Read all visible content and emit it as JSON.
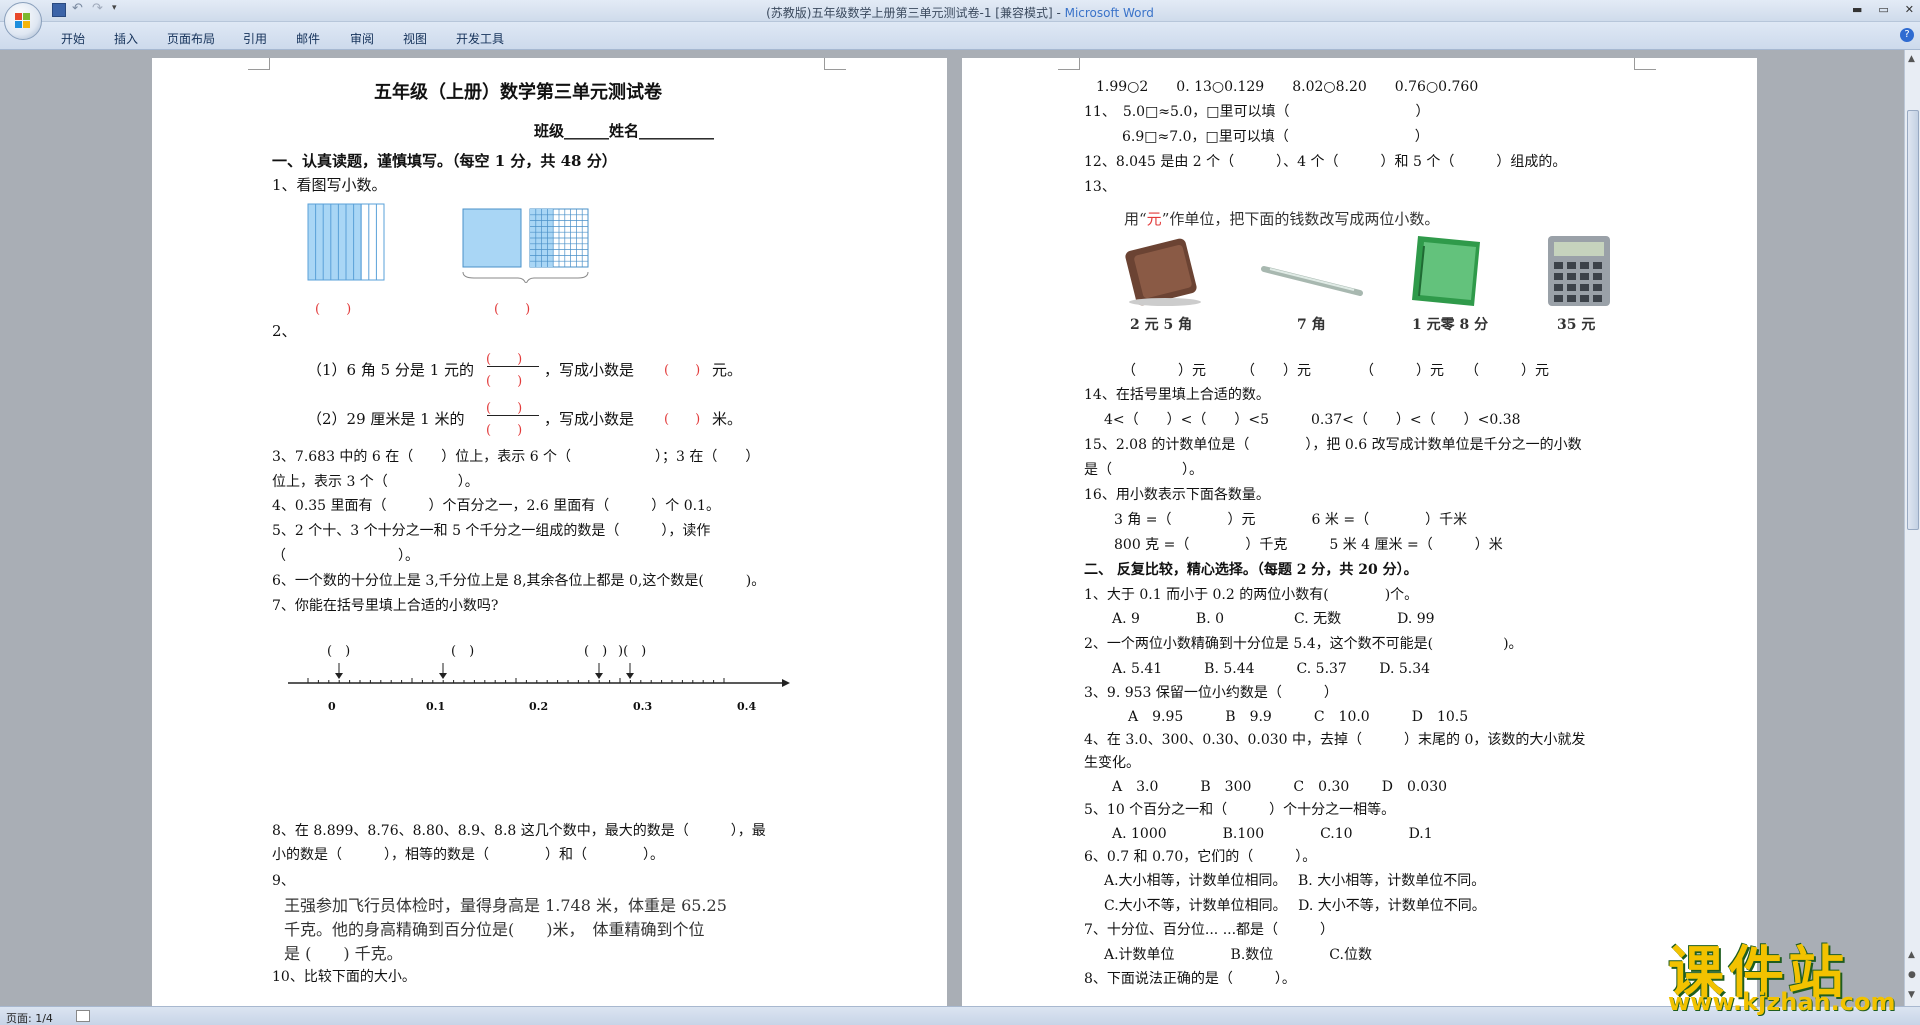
{
  "window": {
    "title_prefix": "(苏教版)五年级数学上册第三单元测试卷-1 [兼容模式] - ",
    "title_app": "Microsoft Word"
  },
  "ribbon": {
    "tabs": [
      "开始",
      "插入",
      "页面布局",
      "引用",
      "邮件",
      "审阅",
      "视图",
      "开发工具"
    ]
  },
  "status": {
    "page": "页面: 1/4"
  },
  "watermark": {
    "main": "课件站",
    "url": "www.kjzhan.com"
  },
  "page1": {
    "title": "五年级（上册）数学第三单元测试卷",
    "classline": "班级______姓名__________",
    "sec1": "一、认真读题，谨慎填写。（每空 1 分，共 48 分）",
    "q1": "1、看图写小数。",
    "q1_blank": "(　　)",
    "q2": "2、",
    "q2_1a": "（1）6 角 5 分是 1 元的",
    "q2_1b": "，写成小数是",
    "q2_1c": "元。",
    "q2_2a": "（2）29 厘米是 1 米的",
    "q2_2b": "，写成小数是",
    "q2_2c": "米。",
    "paren": "(　　)",
    "q3a": "3、7.683 中的 6 在（　　）位上，表示 6 个（　　　　　　）；3 在（　　）",
    "q3b": "位上，表示 3 个（　　　　　）。",
    "q4": "4、0.35 里面有（　　　）个百分之一，2.6 里面有（　　　）个 0.1。",
    "q5a": "5、2 个十、3 个十分之一和 5 个千分之一组成的数是（　　　），读作",
    "q5b": "（　　　　　　　　）。",
    "q6": "6、一个数的十分位上是 3,千分位上是 8,其余各位上都是 0,这个数是(　　　)。",
    "q7": "7、你能在括号里填上合适的小数吗?",
    "numberline": {
      "ticks": [
        "0",
        "0.1",
        "0.2",
        "0.3",
        "0.4"
      ],
      "paren": "(　)",
      "paren2": ")(　)"
    },
    "q8a": "8、在 8.899、8.76、8.80、8.9、8.8 这几个数中，最大的数是（　　　），最",
    "q8b": "小的数是（　　　），相等的数是（　　　　）和（　　　　）。",
    "q9": "9、",
    "q9a": "王强参加飞行员体检时，量得身高是 1.748 米，体重是 65.25",
    "q9b": "千克。他的身高精确到百分位是(　　)米，　体重精确到个位",
    "q9c": "是 (　　) 千克。",
    "q10": "10、比较下面的大小。"
  },
  "page2": {
    "cmp": "1.99○2　　0. 13○0.129　　8.02○8.20　　0.76○0.760",
    "q11a": "11、　5.0□≈5.0，□里可以填（　　　　　　　　　）",
    "q11b": "6.9□≈7.0，□里可以填（　　　　　　　　　）",
    "q12": "12、8.045 是由 2 个（　　　）、4 个（　　　）和 5 个（　　　）组成的。",
    "q13": "13、",
    "q13_inst_a": "用“",
    "q13_inst_yuan": "元",
    "q13_inst_b": "”作单位，把下面的钱数改写成两位小数。",
    "items": [
      "2 元 5 角",
      "7 角",
      "1 元零 8 分",
      "35 元"
    ],
    "q13_answers": "（　　　）元　　　（　　）元　　　　（　　　）元　　（　　　）元",
    "q14": "14、在括号里填上合适的数。",
    "q14b": "4<（　　）<（　　）<5　　　0.37<（　　）<（　　）<0.38",
    "q15a": "15、2.08 的计数单位是（　　　　），把 0.6 改写成计数单位是千分之一的小数",
    "q15b": "是（　　　　　）。",
    "q16": "16、用小数表示下面各数量。",
    "q16a": "3 角 =（　　　　）元　　　　6 米 =（　　　　）千米",
    "q16b": "800 克 =（　　　　）千克　　　5 米 4 厘米 =（　　　）米",
    "sec2": "二、 反复比较，精心选择。（每题 2 分，共 20 分）。",
    "c1": "1、大于 0.1 而小于 0.2 的两位小数有(　　　　)个。",
    "c1o": "A. 9　　　　B. 0　　　　　C. 无数　　　　D. 99",
    "c2": "2、一个两位小数精确到十分位是 5.4，这个数不可能是(　　　　　)。",
    "c2o": "A. 5.41　　　B. 5.44　　　C. 5.37　　 D. 5.34",
    "c3": "3、9. 953 保留一位小约数是（　　　）",
    "c3o": "A　9.95　　　B　9.9　　　C　10.0　　　D　10.5",
    "c4a": "4、在 3.0、300、0.30、0.030 中，去掉（　　　）末尾的 0，该数的大小就发",
    "c4b": "生变化。",
    "c4o": "A　3.0　　　B　300　　　C　0.30　　 D　0.030",
    "c5": "5、10 个百分之一和（　　　）个十分之一相等。",
    "c5o": "A. 1000　　　　B.100　　　　C.10　　　　D.1",
    "c6": "6、0.7 和 0.70，它们的（　　　）。",
    "c6a": "A.大小相等，计数单位相同。　 B. 大小相等，计数单位不同。",
    "c6b": "C.大小不等，计数单位相同。　 D. 大小不等，计数单位不同。",
    "c7": "7、十分位、百分位... ...都是（　　　）",
    "c7o": "A.计数单位　　　　B.数位　　　　C.位数",
    "c8": "8、下面说法正确的是（　　　）。"
  }
}
